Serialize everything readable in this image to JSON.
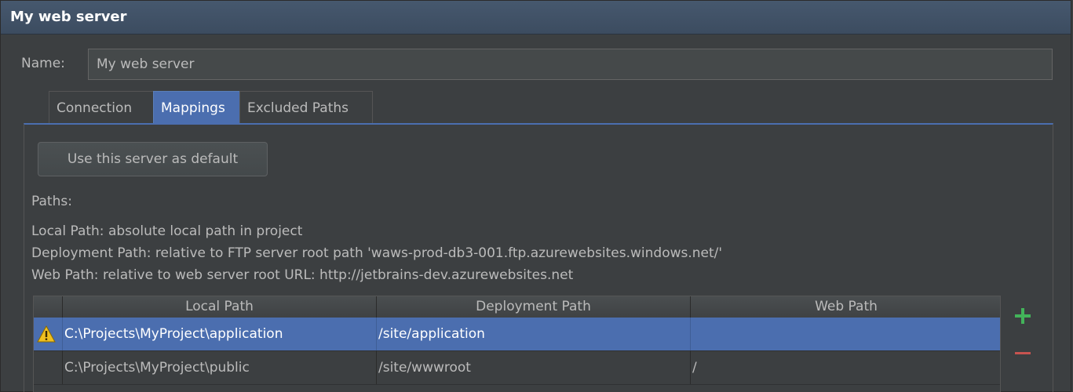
{
  "window": {
    "title": "My web server"
  },
  "name_field": {
    "label": "Name:",
    "value": "My web server"
  },
  "tabs": [
    {
      "label": "Connection",
      "active": false
    },
    {
      "label": "Mappings",
      "active": true
    },
    {
      "label": "Excluded Paths",
      "active": false
    }
  ],
  "default_button": {
    "label": "Use this server as default"
  },
  "paths": {
    "label": "Paths:",
    "info_lines": [
      "Local Path: absolute local path in project",
      "Deployment Path: relative to FTP server root path 'waws-prod-db3-001.ftp.azurewebsites.windows.net/'",
      "Web Path: relative to web server root URL: http://jetbrains-dev.azurewebsites.net"
    ]
  },
  "table": {
    "columns": [
      "Local Path",
      "Deployment Path",
      "Web Path"
    ],
    "rows": [
      {
        "warning": true,
        "selected": true,
        "local_path": "C:\\Projects\\MyProject\\application",
        "deployment_path": "/site/application",
        "web_path": ""
      },
      {
        "warning": false,
        "selected": false,
        "local_path": "C:\\Projects\\MyProject\\public",
        "deployment_path": "/site/wwwroot",
        "web_path": "/"
      }
    ]
  },
  "actions": {
    "add_icon": "plus-icon",
    "remove_icon": "minus-icon",
    "add_color": "#43b35a",
    "remove_color": "#c75450"
  },
  "colors": {
    "accent": "#4b6eaf",
    "background": "#3c3f41",
    "title_bar": "#46586e"
  }
}
